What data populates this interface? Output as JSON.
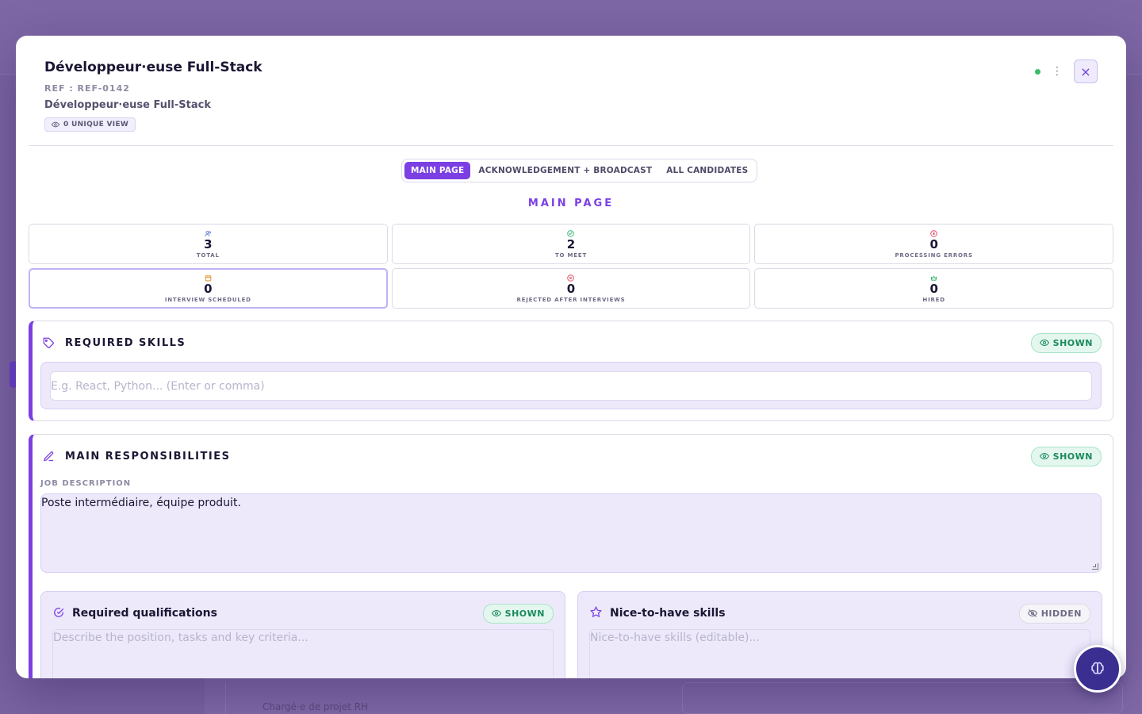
{
  "background": {
    "footer_text": "Chargé·e de projet RH"
  },
  "header": {
    "title": "Développeur·euse Full-Stack",
    "ref": "REF : REF-0142",
    "subtitle": "Développeur·euse Full-Stack",
    "views": "0 UNIQUE VIEW",
    "close_icon": "×",
    "more_icon": "⋮",
    "status_color": "#3dbb6c"
  },
  "tabs": [
    {
      "label": "MAIN PAGE",
      "active": true
    },
    {
      "label": "ACKNOWLEDGEMENT + BROADCAST",
      "active": false
    },
    {
      "label": "ALL CANDIDATES",
      "active": false
    }
  ],
  "section_title": "MAIN PAGE",
  "stats": [
    {
      "icon": "users-icon",
      "icon_color": "#7b8cd6",
      "value": "3",
      "label": "TOTAL"
    },
    {
      "icon": "check-circle-icon",
      "icon_color": "#2fb36a",
      "value": "2",
      "label": "TO MEET"
    },
    {
      "icon": "x-circle-icon",
      "icon_color": "#e2445c",
      "value": "0",
      "label": "PROCESSING ERRORS"
    },
    {
      "icon": "calendar-icon",
      "icon_color": "#e0922b",
      "value": "0",
      "label": "INTERVIEW SCHEDULED"
    },
    {
      "icon": "x-circle-icon",
      "icon_color": "#e2445c",
      "value": "0",
      "label": "REJECTED AFTER INTERVIEWS"
    },
    {
      "icon": "crown-icon",
      "icon_color": "#2fb36a",
      "value": "0",
      "label": "HIRED"
    }
  ],
  "required_skills": {
    "title": "REQUIRED SKILLS",
    "badge": "SHOWN",
    "placeholder": "E.g. React, Python... (Enter or comma)"
  },
  "responsibilities": {
    "title": "MAIN RESPONSIBILITIES",
    "badge": "SHOWN",
    "field_label": "JOB DESCRIPTION",
    "value": "Poste intermédiaire, équipe produit."
  },
  "qualifications": {
    "title": "Required qualifications",
    "badge": "SHOWN",
    "placeholder": "Describe the position, tasks and key criteria..."
  },
  "nice_to_have": {
    "title": "Nice-to-have skills",
    "badge": "HIDDEN",
    "placeholder": "Nice-to-have skills (editable)..."
  },
  "colors": {
    "accent": "#7b3fe4",
    "shown": "#1a8a5c",
    "fab": "#3a2f91"
  }
}
